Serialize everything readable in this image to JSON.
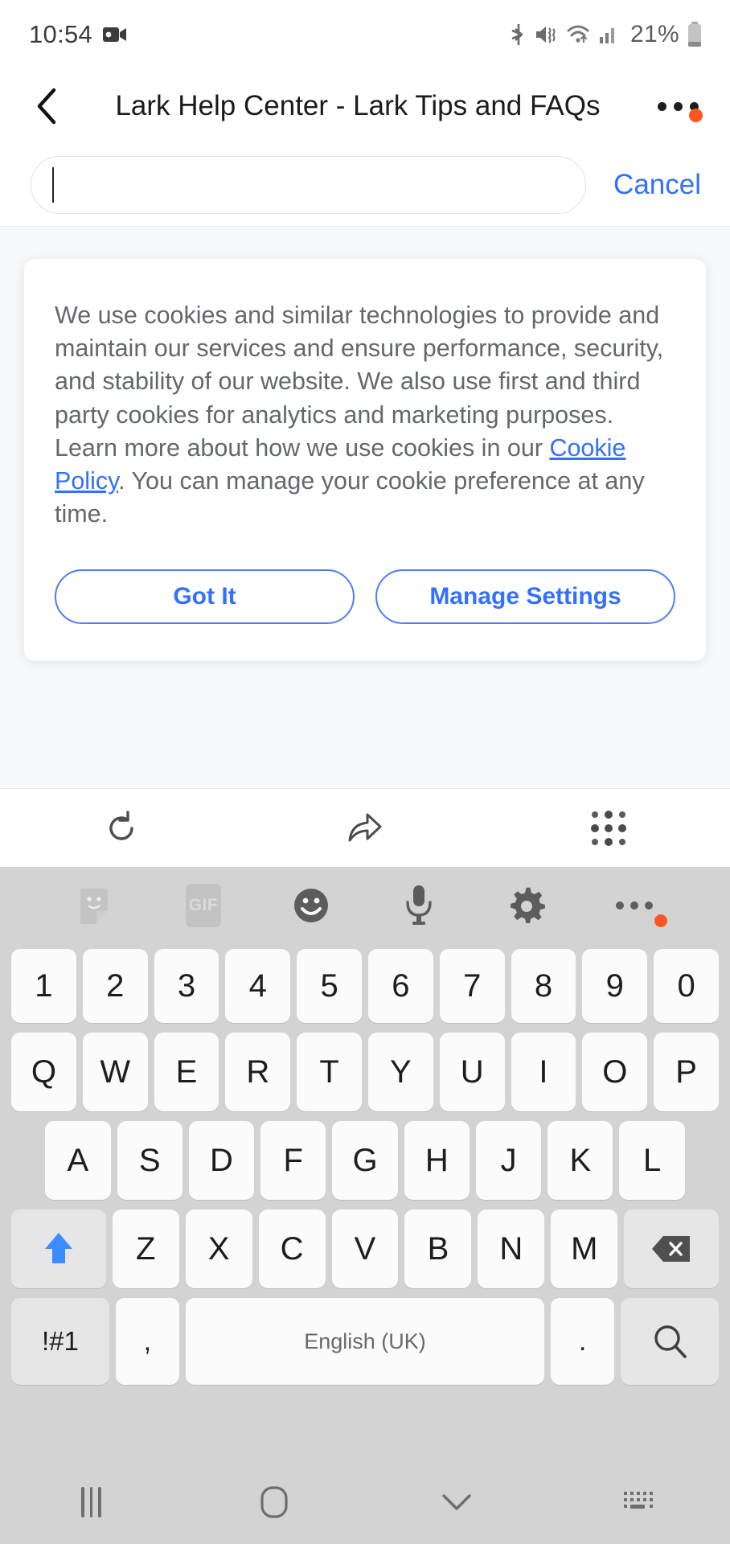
{
  "status_bar": {
    "time": "10:54",
    "battery_percent": "21%",
    "icons": [
      "video-recording-icon",
      "bluetooth-icon",
      "mute-vibrate-icon",
      "wifi-icon",
      "cellular-signal-icon",
      "battery-icon"
    ]
  },
  "header": {
    "title": "Lark Help Center - Lark Tips and FAQs",
    "back_icon": "back-chevron-icon",
    "more_icon": "more-options-icon",
    "has_notification_badge": true,
    "badge_color": "#ff5722"
  },
  "search": {
    "value": "",
    "placeholder": "",
    "cancel_label": "Cancel"
  },
  "cookie_banner": {
    "text_before_link": "We use cookies and similar technologies to provide and maintain our services and ensure performance, security, and stability of our website. We also use first and third party cookies for analytics and marketing purposes. Learn more about how we use cookies in our ",
    "link_label": "Cookie Policy",
    "text_after_link": ". You can manage your cookie preference at any time.",
    "primary_button": "Got It",
    "secondary_button": "Manage Settings",
    "accent_color": "#3370ff"
  },
  "browser_toolbar": {
    "items": [
      {
        "name": "refresh-icon",
        "label": "Refresh"
      },
      {
        "name": "share-icon",
        "label": "Share"
      },
      {
        "name": "apps-grid-icon",
        "label": "Menu"
      }
    ]
  },
  "keyboard": {
    "toolbar": [
      {
        "name": "sticker-icon",
        "label": "Stickers"
      },
      {
        "name": "gif-icon",
        "label": "GIF"
      },
      {
        "name": "emoji-icon",
        "label": "Emoji"
      },
      {
        "name": "microphone-icon",
        "label": "Voice input"
      },
      {
        "name": "gear-icon",
        "label": "Settings"
      },
      {
        "name": "more-options-icon",
        "label": "More"
      }
    ],
    "row_numbers": [
      "1",
      "2",
      "3",
      "4",
      "5",
      "6",
      "7",
      "8",
      "9",
      "0"
    ],
    "row_top": [
      "Q",
      "W",
      "E",
      "R",
      "T",
      "Y",
      "U",
      "I",
      "O",
      "P"
    ],
    "row_home": [
      "A",
      "S",
      "D",
      "F",
      "G",
      "H",
      "J",
      "K",
      "L"
    ],
    "row_bottom": [
      "Z",
      "X",
      "C",
      "V",
      "B",
      "N",
      "M"
    ],
    "shift_label": "shift-icon",
    "backspace_label": "backspace-icon",
    "symbols_key": "!#1",
    "comma_key": ",",
    "space_key": "English (UK)",
    "period_key": ".",
    "enter_key": "search-icon",
    "shift_active": true,
    "shift_color": "#3a8dff"
  },
  "nav_bar": {
    "items": [
      {
        "name": "recents-icon",
        "label": "Recents"
      },
      {
        "name": "home-icon",
        "label": "Home"
      },
      {
        "name": "hide-keyboard-icon",
        "label": "Hide keyboard"
      },
      {
        "name": "keyboard-switch-icon",
        "label": "Switch keyboard"
      }
    ]
  }
}
